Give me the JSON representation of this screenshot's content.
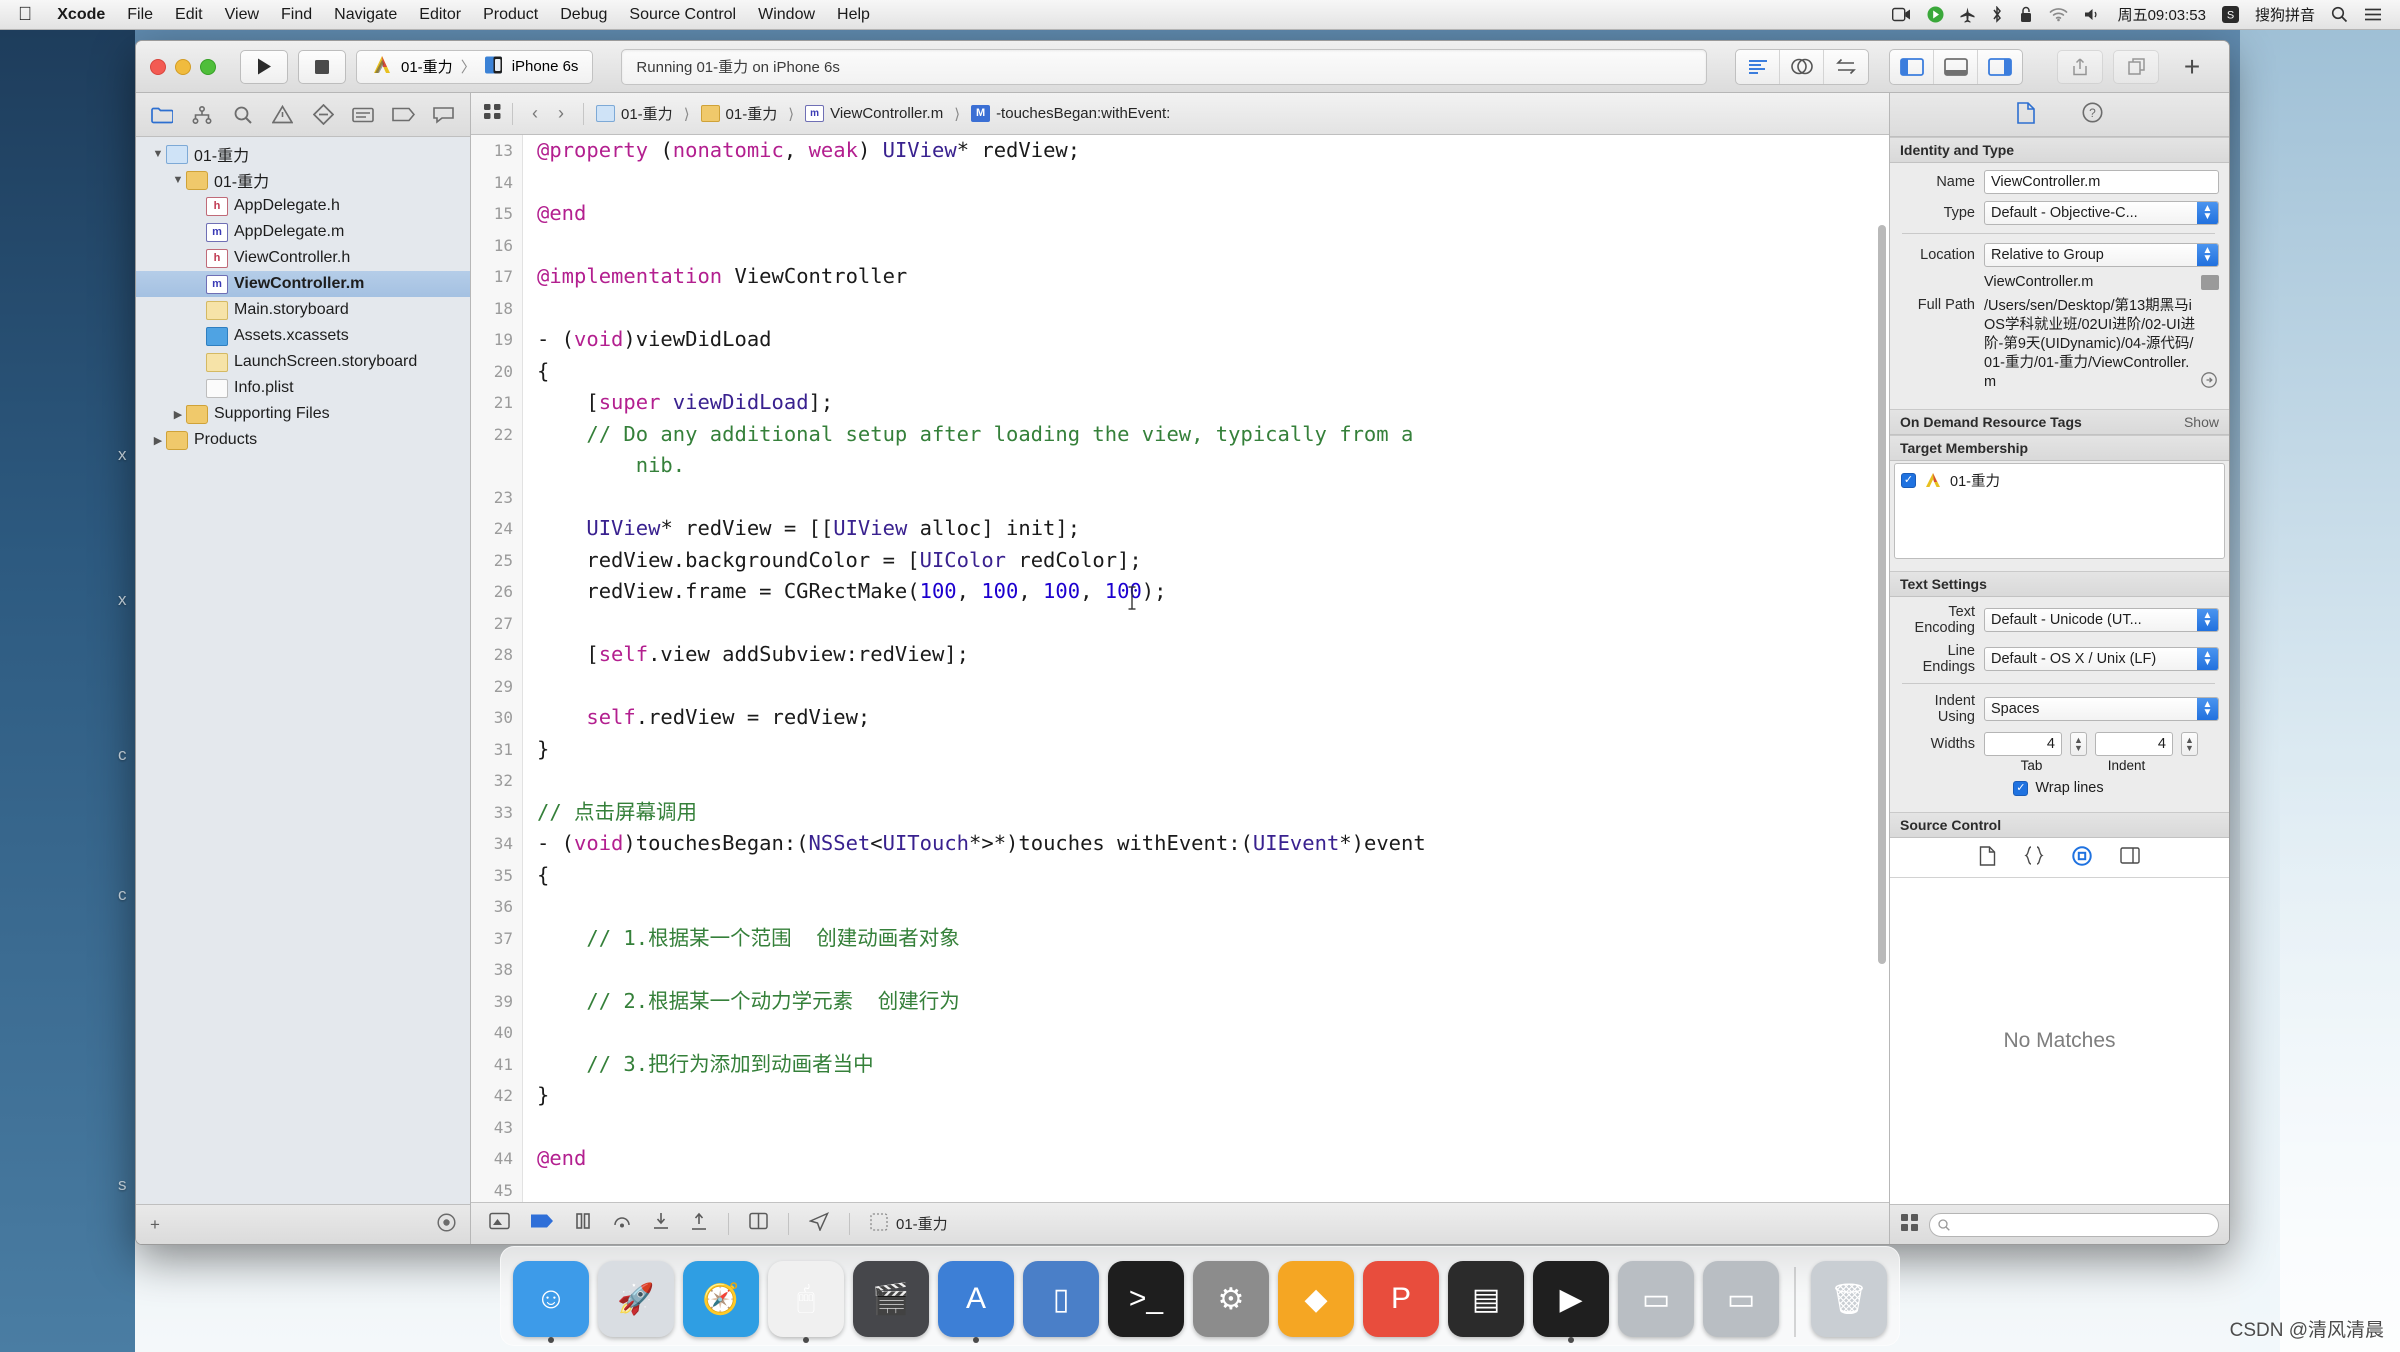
{
  "menubar": {
    "apple_icon": "apple-logo-icon",
    "items": [
      "Xcode",
      "File",
      "Edit",
      "View",
      "Find",
      "Navigate",
      "Editor",
      "Product",
      "Debug",
      "Source Control",
      "Window",
      "Help"
    ],
    "status": {
      "screen_record_icon": "screen-record-icon",
      "media_icon": "media-play-icon",
      "flight_icon": "airplane-icon",
      "bluetooth_icon": "bluetooth-icon",
      "lock_icon": "lock-icon",
      "wifi_icon": "wifi-icon",
      "volume_icon": "volume-icon",
      "clock": "周五09:03:53",
      "input_method_badge": "S",
      "input_method": "搜狗拼音",
      "search_icon": "search-icon",
      "notification_icon": "notification-center-icon"
    }
  },
  "toolbar": {
    "run_label": "▶",
    "stop_label": "■",
    "scheme_project": "01-重力",
    "scheme_separator": "〉",
    "scheme_device": "iPhone 6s",
    "status_text": "Running 01-重力 on iPhone 6s",
    "editor_modes": [
      "standard-editor-icon",
      "assistant-editor-icon",
      "version-editor-icon"
    ],
    "panel_toggles": [
      "navigator-toggle-icon",
      "debug-area-toggle-icon",
      "inspector-toggle-icon"
    ],
    "share_icon": "share-icon",
    "organizer_icon": "organizer-icon",
    "add_label": "+"
  },
  "navigator": {
    "tabs": [
      "project-navigator-icon",
      "source-control-navigator-icon",
      "find-navigator-icon",
      "issue-navigator-icon",
      "test-navigator-icon",
      "debug-navigator-icon",
      "breakpoint-navigator-icon",
      "report-navigator-icon"
    ],
    "selected_tab": 0,
    "tree": [
      {
        "label": "01-重力",
        "icon": "project-icon",
        "depth": 0,
        "twisty": "▼",
        "selected": false
      },
      {
        "label": "01-重力",
        "icon": "folder-icon",
        "depth": 1,
        "twisty": "▼",
        "selected": false
      },
      {
        "label": "AppDelegate.h",
        "icon": "header-file-icon",
        "depth": 2,
        "twisty": "",
        "selected": false
      },
      {
        "label": "AppDelegate.m",
        "icon": "objc-file-icon",
        "depth": 2,
        "twisty": "",
        "selected": false
      },
      {
        "label": "ViewController.h",
        "icon": "header-file-icon",
        "depth": 2,
        "twisty": "",
        "selected": false
      },
      {
        "label": "ViewController.m",
        "icon": "objc-file-icon",
        "depth": 2,
        "twisty": "",
        "selected": true
      },
      {
        "label": "Main.storyboard",
        "icon": "storyboard-icon",
        "depth": 2,
        "twisty": "",
        "selected": false
      },
      {
        "label": "Assets.xcassets",
        "icon": "assets-icon",
        "depth": 2,
        "twisty": "",
        "selected": false
      },
      {
        "label": "LaunchScreen.storyboard",
        "icon": "storyboard-icon",
        "depth": 2,
        "twisty": "",
        "selected": false
      },
      {
        "label": "Info.plist",
        "icon": "plist-icon",
        "depth": 2,
        "twisty": "",
        "selected": false
      },
      {
        "label": "Supporting Files",
        "icon": "folder-icon",
        "depth": 1,
        "twisty": "▶",
        "selected": false
      },
      {
        "label": "Products",
        "icon": "folder-icon",
        "depth": 0,
        "twisty": "▶",
        "selected": false
      }
    ],
    "footer": {
      "add_label": "+",
      "filter_icon": "filter-circle-icon",
      "recent_icon": "clock-icon",
      "source-control-icon": "source-control-filter-icon"
    }
  },
  "jumpbar": {
    "related_icon": "related-items-icon",
    "back_label": "‹",
    "forward_label": "›",
    "crumbs": [
      {
        "label": "01-重力",
        "icon": "project-icon"
      },
      {
        "label": "01-重力",
        "icon": "folder-icon"
      },
      {
        "label": "ViewController.m",
        "icon": "objc-file-icon"
      },
      {
        "label": "-touchesBegan:withEvent:",
        "icon": "method-icon"
      }
    ],
    "right_icons": [
      "new-document-icon",
      "help-icon"
    ]
  },
  "code": {
    "first_line_number": 13,
    "lines": [
      {
        "n": 13,
        "tokens": [
          {
            "t": "@property",
            "c": "k"
          },
          {
            "t": " ",
            "c": "pl"
          },
          {
            "t": "(",
            "c": "pl"
          },
          {
            "t": "nonatomic",
            "c": "k"
          },
          {
            "t": ", ",
            "c": "pl"
          },
          {
            "t": "weak",
            "c": "k"
          },
          {
            "t": ") ",
            "c": "pl"
          },
          {
            "t": "UIView",
            "c": "ty"
          },
          {
            "t": "* redView;",
            "c": "pl"
          }
        ]
      },
      {
        "n": 14,
        "tokens": []
      },
      {
        "n": 15,
        "tokens": [
          {
            "t": "@end",
            "c": "k"
          }
        ]
      },
      {
        "n": 16,
        "tokens": []
      },
      {
        "n": 17,
        "tokens": [
          {
            "t": "@implementation",
            "c": "k"
          },
          {
            "t": " ",
            "c": "pl"
          },
          {
            "t": "ViewController",
            "c": "pl"
          }
        ]
      },
      {
        "n": 18,
        "tokens": []
      },
      {
        "n": 19,
        "tokens": [
          {
            "t": "- (",
            "c": "pl"
          },
          {
            "t": "void",
            "c": "k"
          },
          {
            "t": ")viewDidLoad",
            "c": "pl"
          }
        ]
      },
      {
        "n": 20,
        "tokens": [
          {
            "t": "{",
            "c": "pl"
          }
        ]
      },
      {
        "n": 21,
        "tokens": [
          {
            "t": "    [",
            "c": "pl"
          },
          {
            "t": "super",
            "c": "k"
          },
          {
            "t": " ",
            "c": "pl"
          },
          {
            "t": "viewDidLoad",
            "c": "ty"
          },
          {
            "t": "];",
            "c": "pl"
          }
        ]
      },
      {
        "n": 22,
        "tokens": [
          {
            "t": "    // Do any additional setup after loading the view, typically from a",
            "c": "cm"
          }
        ]
      },
      {
        "n": "",
        "tokens": [
          {
            "t": "        nib.",
            "c": "cm"
          }
        ]
      },
      {
        "n": 23,
        "tokens": []
      },
      {
        "n": 24,
        "tokens": [
          {
            "t": "    ",
            "c": "pl"
          },
          {
            "t": "UIView",
            "c": "ty"
          },
          {
            "t": "* redView = [[",
            "c": "pl"
          },
          {
            "t": "UIView",
            "c": "ty"
          },
          {
            "t": " alloc] init];",
            "c": "pl"
          }
        ]
      },
      {
        "n": 25,
        "tokens": [
          {
            "t": "    redView.backgroundColor = [",
            "c": "pl"
          },
          {
            "t": "UIColor",
            "c": "ty"
          },
          {
            "t": " redColor];",
            "c": "pl"
          }
        ]
      },
      {
        "n": 26,
        "tokens": [
          {
            "t": "    redView.frame = CGRectMake(",
            "c": "pl"
          },
          {
            "t": "100",
            "c": "num"
          },
          {
            "t": ", ",
            "c": "pl"
          },
          {
            "t": "100",
            "c": "num"
          },
          {
            "t": ", ",
            "c": "pl"
          },
          {
            "t": "100",
            "c": "num"
          },
          {
            "t": ", ",
            "c": "pl"
          },
          {
            "t": "100",
            "c": "num"
          },
          {
            "t": ");",
            "c": "pl"
          }
        ]
      },
      {
        "n": 27,
        "tokens": []
      },
      {
        "n": 28,
        "tokens": [
          {
            "t": "    [",
            "c": "pl"
          },
          {
            "t": "self",
            "c": "k"
          },
          {
            "t": ".view addSubview:redView];",
            "c": "pl"
          }
        ]
      },
      {
        "n": 29,
        "tokens": []
      },
      {
        "n": 30,
        "tokens": [
          {
            "t": "    ",
            "c": "pl"
          },
          {
            "t": "self",
            "c": "k"
          },
          {
            "t": ".redView = redView;",
            "c": "pl"
          }
        ]
      },
      {
        "n": 31,
        "tokens": [
          {
            "t": "}",
            "c": "pl"
          }
        ]
      },
      {
        "n": 32,
        "tokens": []
      },
      {
        "n": 33,
        "tokens": [
          {
            "t": "// 点击屏幕调用",
            "c": "cm"
          }
        ]
      },
      {
        "n": 34,
        "tokens": [
          {
            "t": "- (",
            "c": "pl"
          },
          {
            "t": "void",
            "c": "k"
          },
          {
            "t": ")touchesBegan:(",
            "c": "pl"
          },
          {
            "t": "NSSet",
            "c": "ty"
          },
          {
            "t": "<",
            "c": "pl"
          },
          {
            "t": "UITouch",
            "c": "ty"
          },
          {
            "t": "*>*)touches withEvent:(",
            "c": "pl"
          },
          {
            "t": "UIEvent",
            "c": "ty"
          },
          {
            "t": "*)event",
            "c": "pl"
          }
        ]
      },
      {
        "n": 35,
        "tokens": [
          {
            "t": "{",
            "c": "pl"
          }
        ]
      },
      {
        "n": 36,
        "tokens": []
      },
      {
        "n": 37,
        "tokens": [
          {
            "t": "    // 1.根据某一个范围  创建动画者对象",
            "c": "cm"
          }
        ]
      },
      {
        "n": 38,
        "tokens": []
      },
      {
        "n": 39,
        "tokens": [
          {
            "t": "    // 2.根据某一个动力学元素  创建行为",
            "c": "cm"
          }
        ]
      },
      {
        "n": 40,
        "tokens": []
      },
      {
        "n": 41,
        "tokens": [
          {
            "t": "    // 3.把行为添加到动画者当中",
            "c": "cm"
          }
        ]
      },
      {
        "n": 42,
        "tokens": [
          {
            "t": "}",
            "c": "pl"
          }
        ]
      },
      {
        "n": 43,
        "tokens": []
      },
      {
        "n": 44,
        "tokens": [
          {
            "t": "@end",
            "c": "k"
          }
        ]
      },
      {
        "n": 45,
        "tokens": []
      }
    ]
  },
  "editor_footer": {
    "icons": [
      "breakpoints-icon",
      "flag-icon",
      "pause-icon",
      "step-over-icon",
      "step-into-icon",
      "step-out-icon",
      "view-hierarchy-icon",
      "location-icon",
      "thread-icon"
    ],
    "project_label": "01-重力"
  },
  "inspector": {
    "tabs": [
      "file-inspector-icon",
      "quick-help-icon"
    ],
    "selected_tab": 0,
    "identity": {
      "section_title": "Identity and Type",
      "name_label": "Name",
      "name_value": "ViewController.m",
      "type_label": "Type",
      "type_value": "Default - Objective-C...",
      "location_label": "Location",
      "location_value": "Relative to Group",
      "location_file": "ViewController.m",
      "fullpath_label": "Full Path",
      "fullpath_value": "/Users/sen/Desktop/第13期黑马iOS学科就业班/02UI进阶/02-UI进阶-第9天(UIDynamic)/04-源代码/01-重力/01-重力/ViewController.m"
    },
    "odr": {
      "section_title": "On Demand Resource Tags",
      "show_label": "Show"
    },
    "target_membership": {
      "section_title": "Target Membership",
      "items": [
        {
          "label": "01-重力",
          "checked": true
        }
      ]
    },
    "text_settings": {
      "section_title": "Text Settings",
      "encoding_label": "Text Encoding",
      "encoding_value": "Default - Unicode (UT...",
      "line_endings_label": "Line Endings",
      "line_endings_value": "Default - OS X / Unix (LF)",
      "indent_label": "Indent Using",
      "indent_value": "Spaces",
      "widths_label": "Widths",
      "tab_value": "4",
      "indent_value_num": "4",
      "tab_sublabel": "Tab",
      "indent_sublabel": "Indent",
      "wrap_label": "Wrap lines",
      "wrap_checked": true
    },
    "source_control": {
      "section_title": "Source Control"
    },
    "quick_help_icons": [
      "document-icon",
      "braces-icon",
      "target-icon",
      "panel-icon"
    ],
    "no_matches": "No Matches",
    "footer": {
      "library_icon": "library-grid-icon",
      "filter_placeholder": ""
    }
  },
  "dock": {
    "items": [
      {
        "name": "finder-icon",
        "label": "Finder",
        "color": "#3d9be9",
        "glyph": "☺",
        "running": true
      },
      {
        "name": "launchpad-icon",
        "label": "Launchpad",
        "color": "#d9dde2",
        "glyph": "🚀",
        "running": false
      },
      {
        "name": "safari-icon",
        "label": "Safari",
        "color": "#2f9ee3",
        "glyph": "🧭",
        "running": false
      },
      {
        "name": "mouse-app-icon",
        "label": "Mouse",
        "color": "#f0f0f0",
        "glyph": "🖱",
        "running": true
      },
      {
        "name": "video-app-icon",
        "label": "Video",
        "color": "#46474b",
        "glyph": "🎬",
        "running": false
      },
      {
        "name": "xcode-icon",
        "label": "Xcode",
        "color": "#3d7fd6",
        "glyph": "A",
        "running": true
      },
      {
        "name": "simulator-icon",
        "label": "Simulator",
        "color": "#4a7fc8",
        "glyph": "▯",
        "running": false
      },
      {
        "name": "terminal-icon",
        "label": "Terminal",
        "color": "#1e1e1e",
        "glyph": ">_",
        "running": false
      },
      {
        "name": "settings-icon",
        "label": "System Preferences",
        "color": "#8c8c8c",
        "glyph": "⚙",
        "running": false
      },
      {
        "name": "sketch-icon",
        "label": "Sketch",
        "color": "#f5a623",
        "glyph": "◆",
        "running": false
      },
      {
        "name": "keynote-icon",
        "label": "Keynote",
        "color": "#e84d3d",
        "glyph": "P",
        "running": false
      },
      {
        "name": "console-icon",
        "label": "Console",
        "color": "#2b2b2b",
        "glyph": "▤",
        "running": false
      },
      {
        "name": "media-player-icon",
        "label": "Player",
        "color": "#1f1f1f",
        "glyph": "▶",
        "running": true
      },
      {
        "name": "display-icon",
        "label": "Displays",
        "color": "#b9bec3",
        "glyph": "▭",
        "running": false
      },
      {
        "name": "display2-icon",
        "label": "Displays",
        "color": "#b9bec3",
        "glyph": "▭",
        "running": false
      },
      {
        "name": "trash-icon",
        "label": "Trash",
        "color": "#c9ced3",
        "glyph": "🗑",
        "running": false
      }
    ],
    "separator_after_index": 14
  },
  "desktop": {
    "ghost_labels": [
      "x",
      "x",
      "c",
      "c",
      "s"
    ],
    "watermark": "CSDN @清风清晨"
  }
}
